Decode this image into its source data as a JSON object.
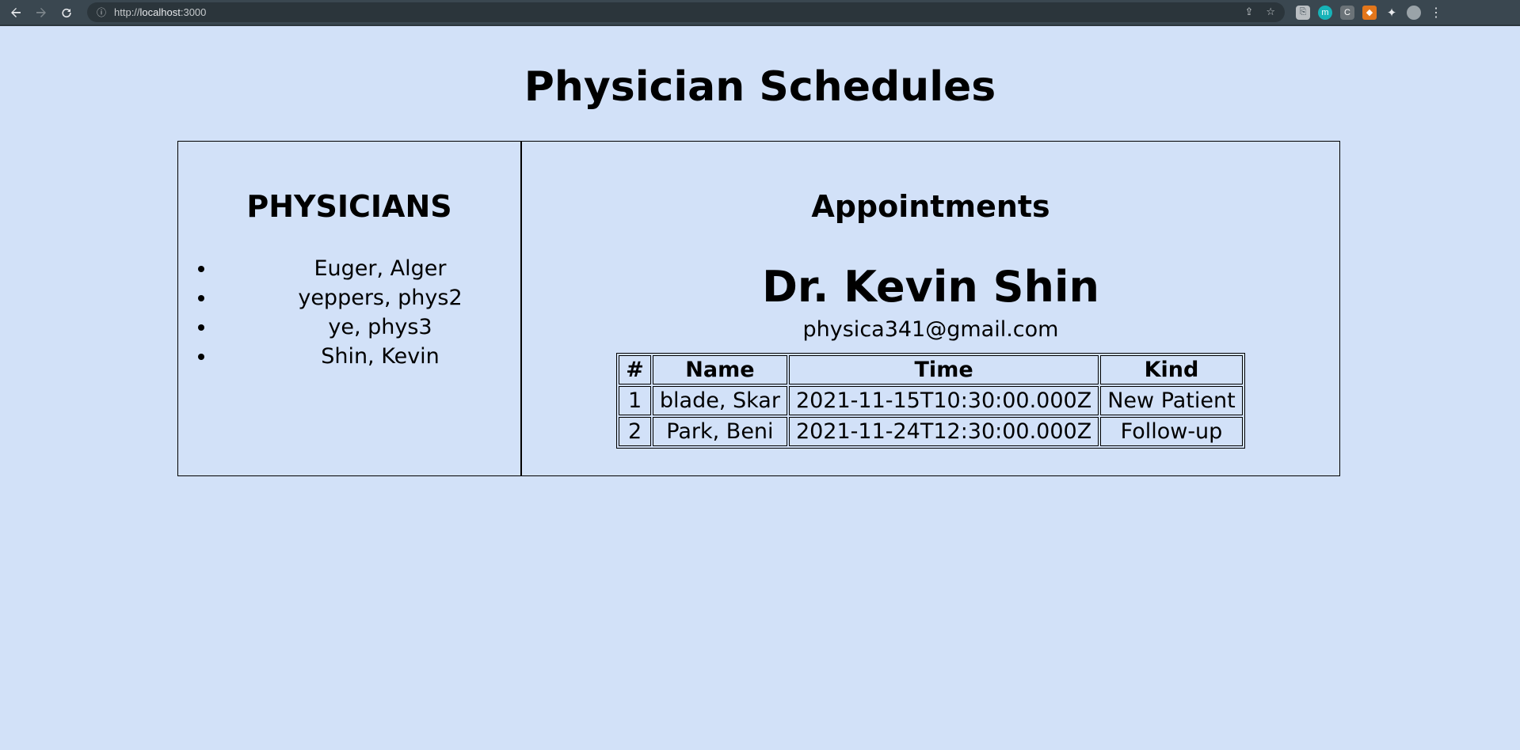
{
  "browser": {
    "url_scheme": "http://",
    "url_host": "localhost",
    "url_port": ":3000"
  },
  "page": {
    "title": "Physician Schedules"
  },
  "physicians": {
    "heading": "PHYSICIANS",
    "items": [
      {
        "label": "Euger, Alger"
      },
      {
        "label": "yeppers, phys2"
      },
      {
        "label": "ye, phys3"
      },
      {
        "label": "Shin, Kevin"
      }
    ]
  },
  "appointments": {
    "heading": "Appointments",
    "doctor_name": "Dr. Kevin Shin",
    "doctor_email": "physica341@gmail.com",
    "columns": [
      "#",
      "Name",
      "Time",
      "Kind"
    ],
    "rows": [
      [
        "1",
        "blade, Skar",
        "2021-11-15T10:30:00.000Z",
        "New Patient"
      ],
      [
        "2",
        "Park, Beni",
        "2021-11-24T12:30:00.000Z",
        "Follow-up"
      ]
    ]
  }
}
